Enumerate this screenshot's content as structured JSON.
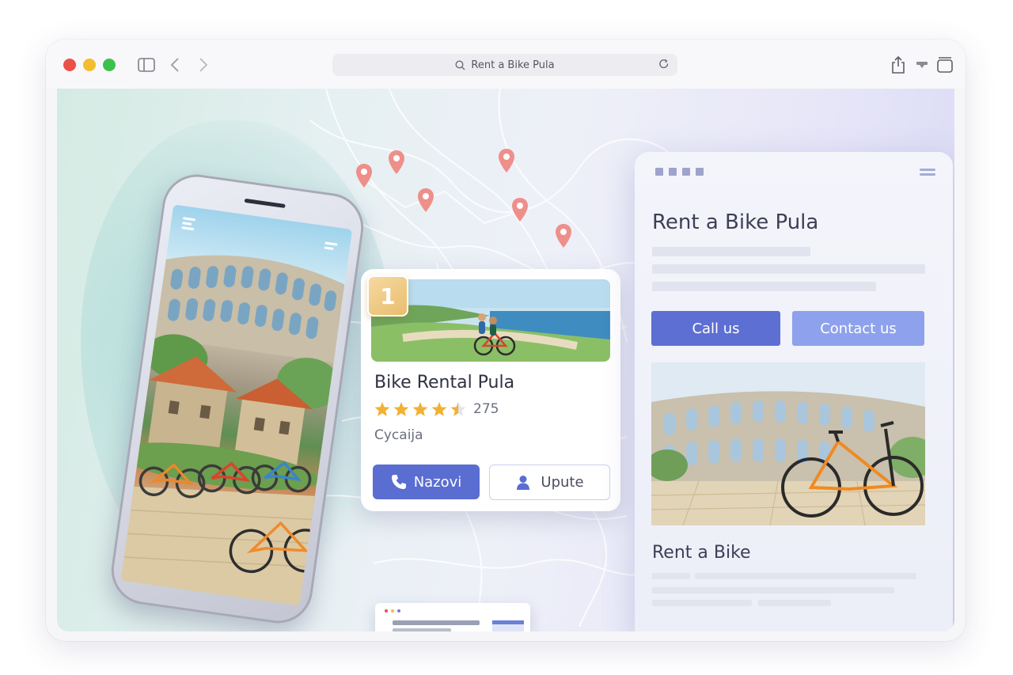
{
  "browser": {
    "address_text": "Rent a Bike Pula",
    "icons": [
      "sidebar-icon",
      "back-icon",
      "forward-icon",
      "search-icon",
      "reload-icon",
      "share-icon",
      "download-icon",
      "tabs-icon"
    ]
  },
  "listing_card": {
    "rank": "1",
    "title": "Bike Rental Pula",
    "rating": 4.5,
    "review_count": "275",
    "category": "Cycaija",
    "call_label": "Nazovi",
    "directions_label": "Upute"
  },
  "website": {
    "title": "Rent a Bike Pula",
    "call_label": "Call us",
    "contact_label": "Contact us",
    "subtitle": "Rent a Bike"
  },
  "colors": {
    "accent": "#5a6dd1",
    "accent_light": "#8ea1ec",
    "star": "#f2b134",
    "pin": "#ee8f8a",
    "window_red": "#ea5148",
    "window_yellow": "#f4bd2f",
    "window_green": "#3cc14d"
  }
}
